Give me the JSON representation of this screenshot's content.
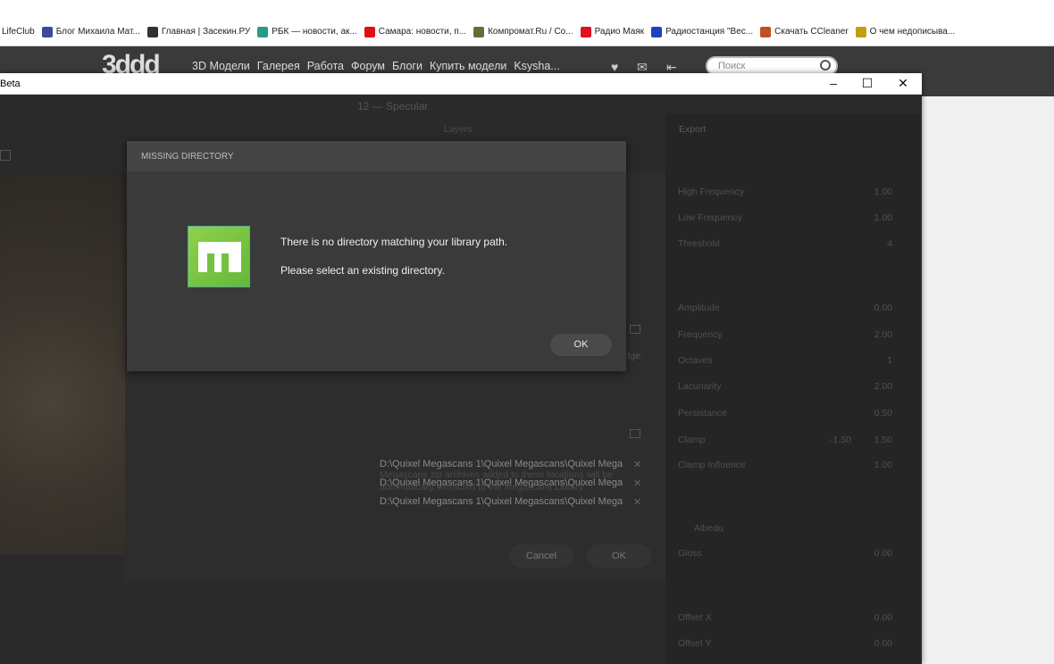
{
  "bookmarks": [
    {
      "label": "LifeClub",
      "color": "#ffffff"
    },
    {
      "label": "Блог Михаила Мат...",
      "color": "#3b4aa0"
    },
    {
      "label": "Главная | Засекин.РУ",
      "color": "#333333"
    },
    {
      "label": "РБК — новости, ак...",
      "color": "#2a9a8a"
    },
    {
      "label": "Самара: новости, п...",
      "color": "#e01010"
    },
    {
      "label": "Компромат.Ru / Co...",
      "color": "#6b6b3a"
    },
    {
      "label": "Радио Маяк",
      "color": "#e01020"
    },
    {
      "label": "Радиостанция \"Вес...",
      "color": "#2040c0"
    },
    {
      "label": "Скачать CCleaner",
      "color": "#c05020"
    },
    {
      "label": "О чем недописыва...",
      "color": "#c0a010"
    }
  ],
  "site": {
    "logo": "3ddd",
    "links": [
      "3D Модели",
      "Галерея",
      "Работа",
      "Форум",
      "Блоги",
      "Купить модели",
      "Ksysha..."
    ],
    "search_placeholder": "Поиск"
  },
  "window": {
    "title": "Beta",
    "minimize": "–",
    "maximize": "☐",
    "close": "✕"
  },
  "app": {
    "title": "12 — Specular",
    "tabs": [
      "Layers",
      "Export"
    ]
  },
  "right_panel": {
    "rows": [
      {
        "label": "High Frequency",
        "value": "1.00"
      },
      {
        "label": "Low Frequency",
        "value": "1.00"
      },
      {
        "label": "Threshold",
        "value": "4"
      },
      {
        "label": "Amplitude",
        "value": "0.00"
      },
      {
        "label": "Frequency",
        "value": "2.00"
      },
      {
        "label": "Octaves",
        "value": "1"
      },
      {
        "label": "Lacunarity",
        "value": "2.00"
      },
      {
        "label": "Persistance",
        "value": "0.50"
      },
      {
        "label": "Clamp",
        "value": "1.50",
        "value_min": "-1.50"
      },
      {
        "label": "Clamp Influence",
        "value": "1.00"
      },
      {
        "label": "Albedo",
        "value": ""
      },
      {
        "label": "Gloss",
        "value": "0.00"
      },
      {
        "label": "Offset X",
        "value": "0.00"
      },
      {
        "label": "Offset Y",
        "value": "0.00"
      }
    ]
  },
  "settings": {
    "partial_text": "idge.",
    "paths": [
      "D:\\Quixel Megascans 1\\Quixel Megascans\\Quixel Mega",
      "D:\\Quixel Megascans 1\\Quixel Megascans\\Quixel Mega",
      "D:\\Quixel Megascans 1\\Quixel Megascans\\Quixel Mega"
    ],
    "hint": "Megascans zip archives added to these locations will be automatically extracted to the Megascans Library",
    "cancel": "Cancel",
    "ok": "OK"
  },
  "dialog": {
    "title": "MISSING DIRECTORY",
    "line1": "There is no directory matching your library path.",
    "line2": "Please select an existing directory.",
    "ok": "OK"
  }
}
